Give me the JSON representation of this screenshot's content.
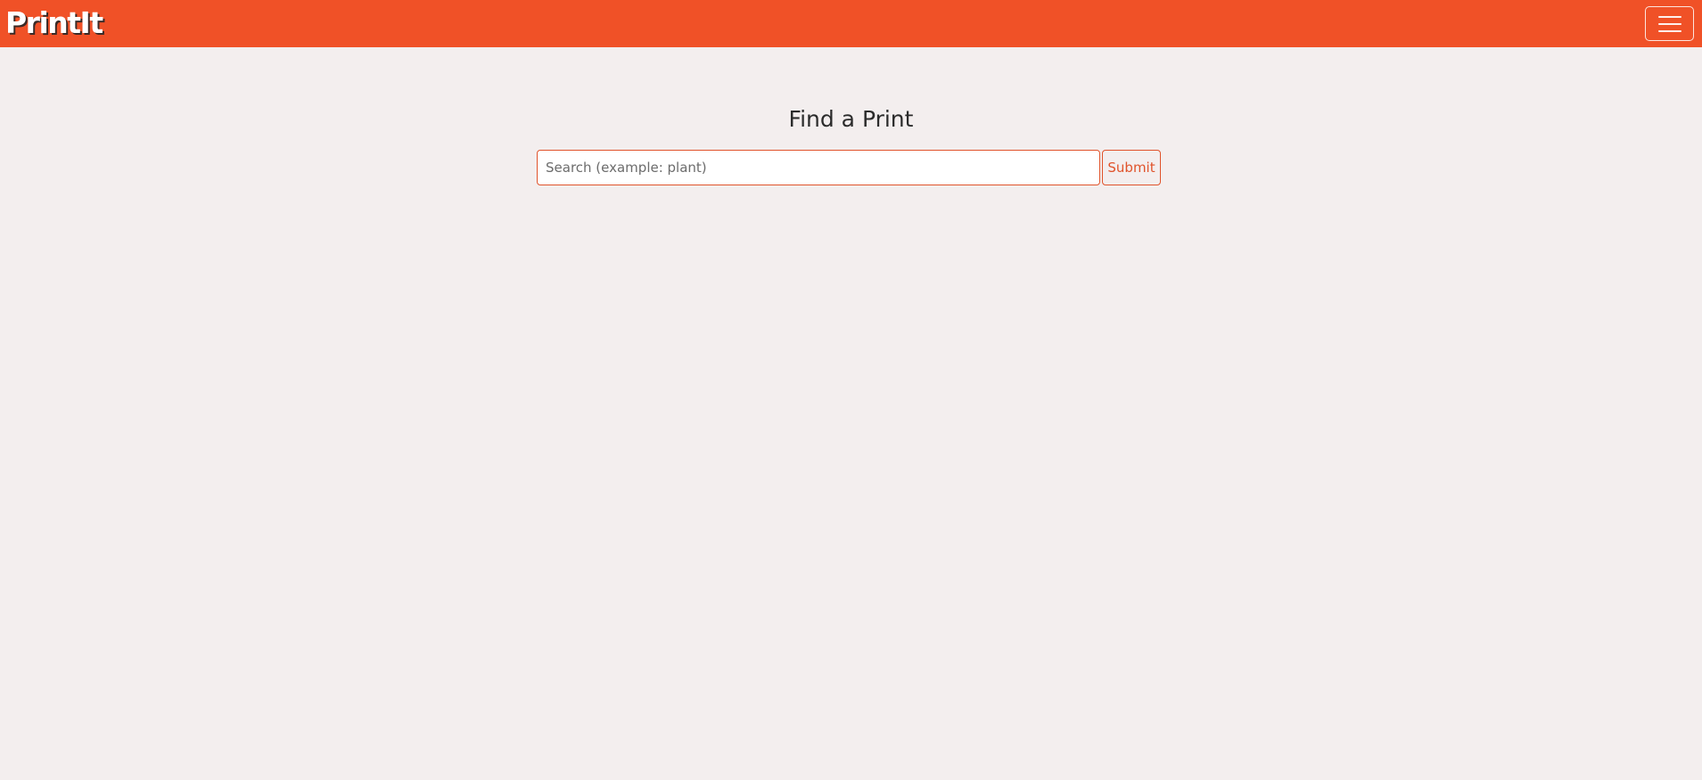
{
  "header": {
    "brand": "PrintIt",
    "menu_toggle_icon": "hamburger-menu-icon",
    "background_color": "#f05127"
  },
  "main": {
    "title": "Find a Print",
    "search": {
      "value": "",
      "placeholder": "Search (example: plant)"
    },
    "submit_label": "Submit",
    "accent_color": "#e0532b"
  },
  "page": {
    "background_color": "#f3eeee"
  }
}
